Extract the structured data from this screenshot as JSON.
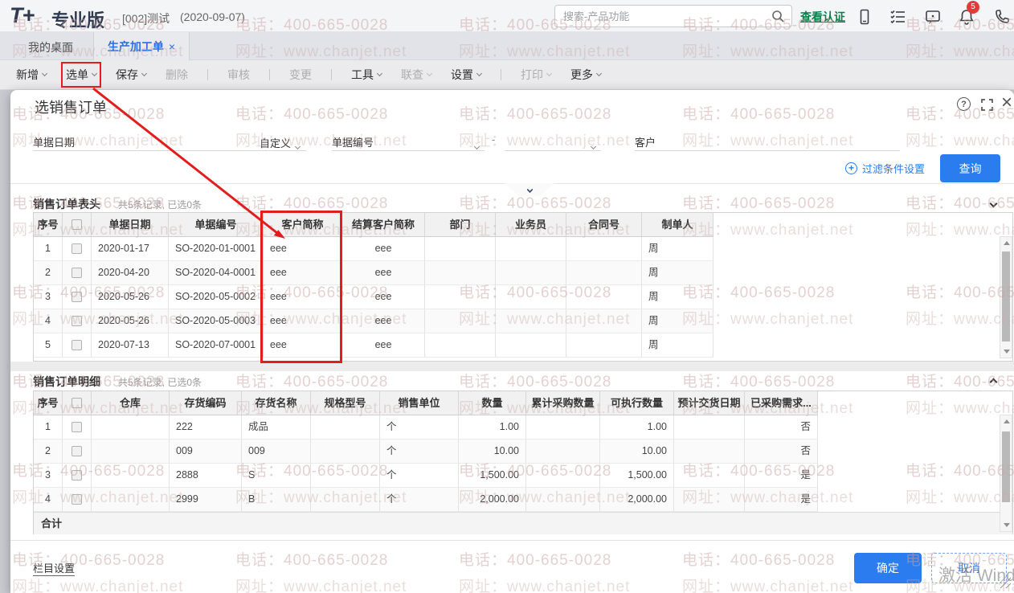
{
  "topbar": {
    "logo": "T+",
    "edition": "专业版",
    "account": "[002]测试",
    "date": "(2020-09-07)",
    "search_placeholder": "搜索-产品功能",
    "verify_link": "查看认证",
    "notification_badge": "5"
  },
  "tabs": [
    {
      "label": "我的桌面",
      "active": false
    },
    {
      "label": "生产加工单",
      "active": true,
      "closable": true
    }
  ],
  "toolbar": {
    "items": [
      {
        "id": "new",
        "label": "新增",
        "caret": true,
        "enabled": true
      },
      {
        "id": "select",
        "label": "选单",
        "caret": true,
        "enabled": true,
        "highlighted": true
      },
      {
        "id": "save",
        "label": "保存",
        "caret": true,
        "enabled": true
      },
      {
        "id": "delete",
        "label": "删除",
        "caret": false,
        "enabled": false
      },
      {
        "type": "separator"
      },
      {
        "id": "audit",
        "label": "审核",
        "caret": false,
        "enabled": false
      },
      {
        "type": "separator"
      },
      {
        "id": "change",
        "label": "变更",
        "caret": false,
        "enabled": false
      },
      {
        "type": "separator"
      },
      {
        "id": "tools",
        "label": "工具",
        "caret": true,
        "enabled": true
      },
      {
        "id": "linkquery",
        "label": "联查",
        "caret": true,
        "enabled": false
      },
      {
        "id": "settings",
        "label": "设置",
        "caret": true,
        "enabled": true
      },
      {
        "type": "separator"
      },
      {
        "id": "print",
        "label": "打印",
        "caret": true,
        "enabled": false
      },
      {
        "id": "more",
        "label": "更多",
        "caret": true,
        "enabled": true
      }
    ]
  },
  "dialog": {
    "title": "选销售订单",
    "filters": {
      "date_label": "单据日期",
      "date_range_type": "自定义",
      "code_label": "单据编号",
      "range_separator": "-",
      "customer_label": "客户",
      "filter_settings_label": "过滤条件设置",
      "query_button": "查询"
    },
    "header_section": {
      "title": "销售订单表头",
      "count": "共5条记录, 已选0条",
      "columns": [
        "序号",
        "单据日期",
        "单据编号",
        "客户简称",
        "结算客户简称",
        "部门",
        "业务员",
        "合同号",
        "制单人"
      ],
      "rows": [
        [
          "1",
          "2020-01-17",
          "SO-2020-01-0001",
          "eee",
          "eee",
          "",
          "",
          "",
          "周"
        ],
        [
          "2",
          "2020-04-20",
          "SO-2020-04-0001",
          "eee",
          "eee",
          "",
          "",
          "",
          "周"
        ],
        [
          "3",
          "2020-05-26",
          "SO-2020-05-0002",
          "eee",
          "eee",
          "",
          "",
          "",
          "周"
        ],
        [
          "4",
          "2020-05-26",
          "SO-2020-05-0003",
          "eee",
          "eee",
          "",
          "",
          "",
          "周"
        ],
        [
          "5",
          "2020-07-13",
          "SO-2020-07-0001",
          "eee",
          "eee",
          "",
          "",
          "",
          "周"
        ]
      ]
    },
    "detail_section": {
      "title": "销售订单明细",
      "count": "共5条记录, 已选0条",
      "columns": [
        "序号",
        "仓库",
        "存货编码",
        "存货名称",
        "规格型号",
        "销售单位",
        "数量",
        "累计采购数量",
        "可执行数量",
        "预计交货日期",
        "已采购需求..."
      ],
      "rows": [
        [
          "1",
          "",
          "222",
          "成品",
          "",
          "个",
          "1.00",
          "",
          "1.00",
          "",
          "否"
        ],
        [
          "2",
          "",
          "009",
          "009",
          "",
          "个",
          "10.00",
          "",
          "10.00",
          "",
          "否"
        ],
        [
          "3",
          "",
          "2888",
          "S",
          "",
          "个",
          "1,500.00",
          "",
          "1,500.00",
          "",
          "是"
        ],
        [
          "4",
          "",
          "2999",
          "B",
          "",
          "个",
          "2,000.00",
          "",
          "2,000.00",
          "",
          "是"
        ]
      ],
      "total_label": "合计"
    },
    "footer": {
      "column_settings": "栏目设置",
      "ok": "确定",
      "cancel": "取消"
    }
  },
  "watermark": {
    "phone": "电话：400-665-0028",
    "web": "网址：www.chanjet.net",
    "activate": "激活 Wind"
  },
  "glyphs": {
    "close": "×",
    "help": "?"
  },
  "colors": {
    "accent_blue": "#2b7cee",
    "annotation_red": "#e11d1d",
    "verify_green": "#0a7d4b",
    "badge_red": "#e23c39",
    "active_tab_blue": "#2b6fe0"
  }
}
